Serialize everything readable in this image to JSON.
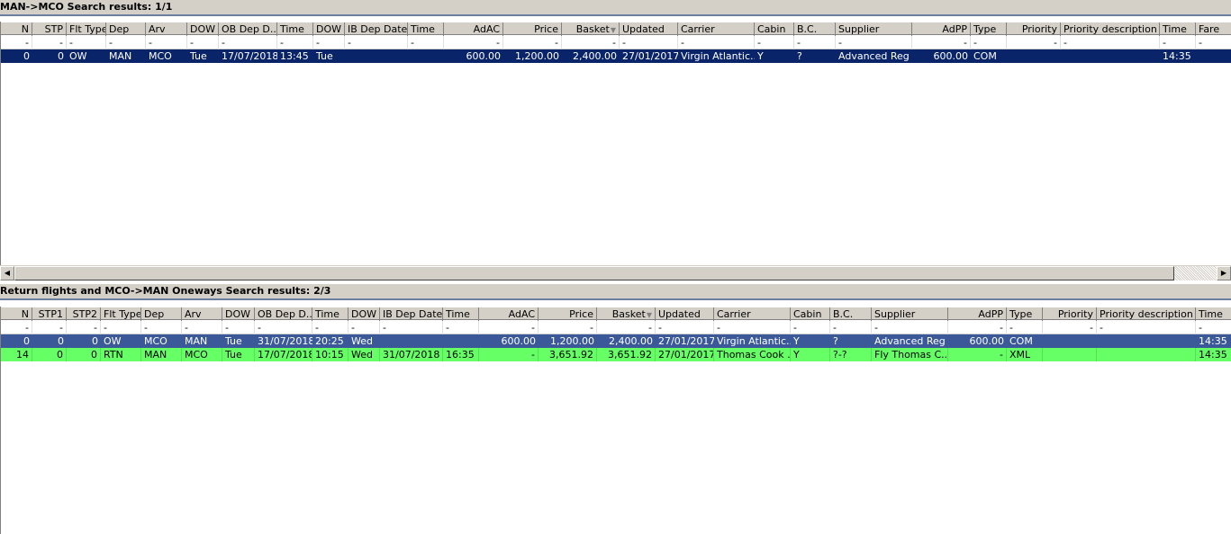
{
  "top_panel": {
    "title": "MAN->MCO Search results: 1/1",
    "columns": [
      "N",
      "STP",
      "Flt Type",
      "Dep",
      "Arv",
      "DOW",
      "OB Dep D...",
      "Time",
      "DOW",
      "IB Dep Date",
      "Time",
      "AdAC",
      "Price",
      "Basket",
      "Updated",
      "Carrier",
      "Cabin",
      "B.C.",
      "Supplier",
      "AdPP",
      "Type",
      "Priority",
      "Priority description",
      "Time",
      "Fare"
    ],
    "filter": [
      "-",
      "-",
      "-",
      "-",
      "-",
      "-",
      "-",
      "-",
      "-",
      "-",
      "-",
      "-",
      "-",
      "-",
      "-",
      "-",
      "-",
      "-",
      "-",
      "-",
      "-",
      "-",
      "-",
      "-",
      "-"
    ],
    "rows": [
      [
        "0",
        "0",
        "OW",
        "MAN",
        "MCO",
        "Tue",
        "17/07/2018",
        "13:45",
        "Tue",
        "",
        "",
        "600.00",
        "1,200.00",
        "2,400.00",
        "27/01/2017",
        "Virgin Atlantic...",
        "Y",
        "?",
        "Advanced Reg",
        "600.00",
        "COM",
        "",
        "",
        "14:35",
        ""
      ]
    ]
  },
  "bottom_panel": {
    "title": "Return flights and MCO->MAN Oneways Search results: 2/3",
    "columns": [
      "N",
      "STP1",
      "STP2",
      "Flt Type",
      "Dep",
      "Arv",
      "DOW",
      "OB Dep D...",
      "Time",
      "DOW",
      "IB Dep Date",
      "Time",
      "AdAC",
      "Price",
      "Basket",
      "Updated",
      "Carrier",
      "Cabin",
      "B.C.",
      "Supplier",
      "AdPP",
      "Type",
      "Priority",
      "Priority description",
      "Time"
    ],
    "filter": [
      "-",
      "-",
      "-",
      "-",
      "-",
      "-",
      "-",
      "-",
      "-",
      "-",
      "-",
      "-",
      "-",
      "-",
      "-",
      "-",
      "-",
      "-",
      "-",
      "-",
      "-",
      "-",
      "-",
      "-",
      "-"
    ],
    "rows": [
      [
        "0",
        "0",
        "0",
        "OW",
        "MCO",
        "MAN",
        "Tue",
        "31/07/2018",
        "20:25",
        "Wed",
        "",
        "",
        "600.00",
        "1,200.00",
        "2,400.00",
        "27/01/2017",
        "Virgin Atlantic...",
        "Y",
        "?",
        "Advanced Reg",
        "600.00",
        "COM",
        "",
        "",
        "14:35"
      ],
      [
        "14",
        "0",
        "0",
        "RTN",
        "MAN",
        "MCO",
        "Tue",
        "17/07/2018",
        "10:15",
        "Wed",
        "31/07/2018",
        "16:35",
        "-",
        "3,651.92",
        "3,651.92",
        "27/01/2017",
        "Thomas Cook ...",
        "Y",
        "?-?",
        "Fly Thomas C...",
        "-",
        "XML",
        "",
        "",
        "14:35"
      ]
    ]
  },
  "scrollbar": {
    "left_arrow": "◀",
    "right_arrow": "▶"
  },
  "colors": {
    "selected_dark": "#0a246a",
    "selected_blue": "#3b5998",
    "highlight_green": "#66ff66",
    "header_bg": "#d4d0c8"
  }
}
